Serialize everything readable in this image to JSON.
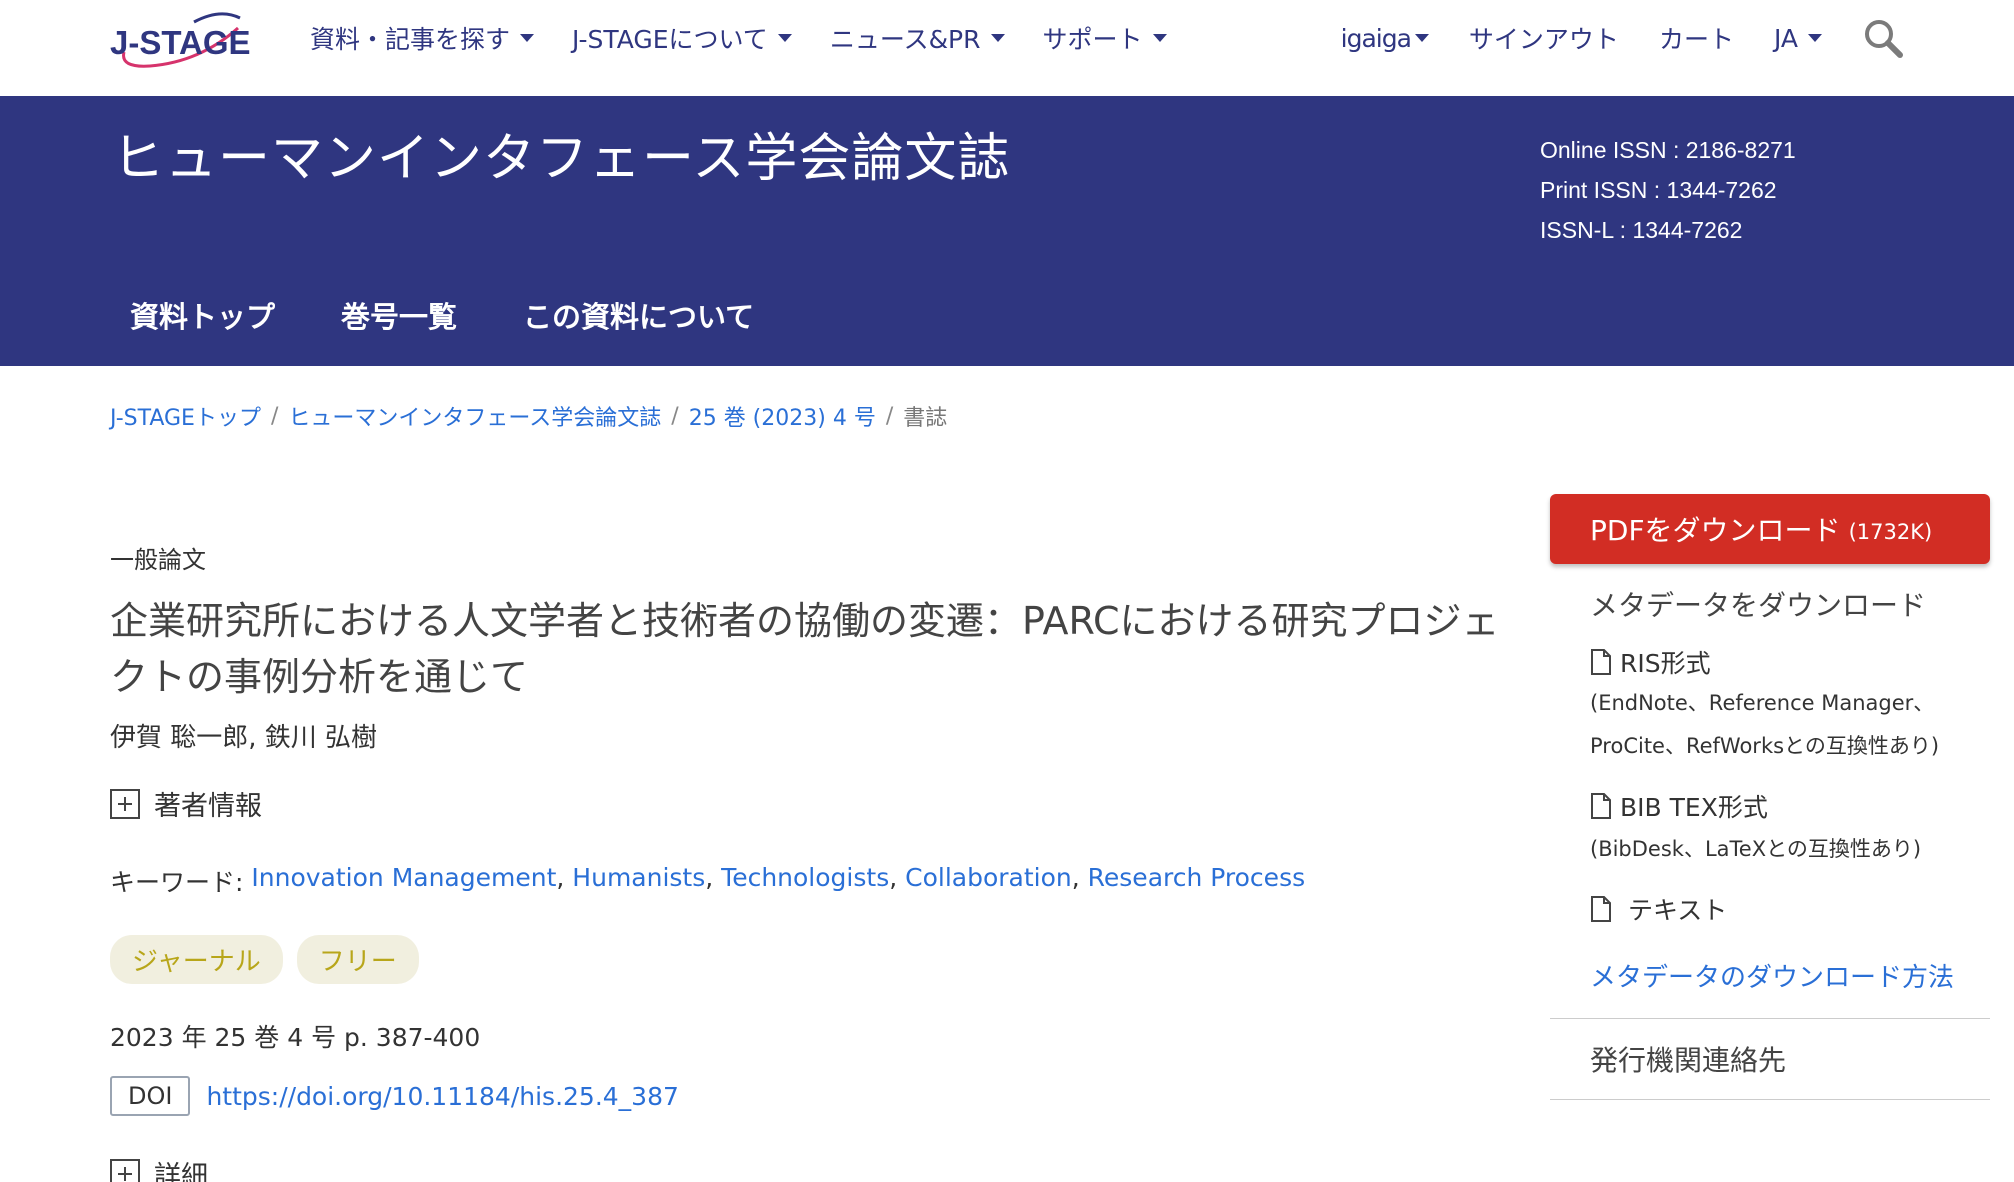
{
  "nav": {
    "menu": [
      {
        "label": "資料・記事を探す"
      },
      {
        "label": "J-STAGEについて"
      },
      {
        "label": "ニュース&PR"
      },
      {
        "label": "サポート"
      }
    ],
    "user": "igaiga",
    "signout": "サインアウト",
    "cart": "カート",
    "language": "JA"
  },
  "logo": {
    "text": "J-STAGE"
  },
  "banner": {
    "journal_title": "ヒューマンインタフェース学会論文誌",
    "issn": {
      "online": "Online ISSN : 2186-8271",
      "print": "Print ISSN : 1344-7262",
      "issn_l": "ISSN-L : 1344-7262"
    },
    "tabs": [
      "資料トップ",
      "巻号一覧",
      "この資料について"
    ]
  },
  "breadcrumb": {
    "items": [
      "J-STAGEトップ",
      "ヒューマンインタフェース学会論文誌",
      "25 巻 (2023) 4 号"
    ],
    "current": "書誌",
    "separator": "/"
  },
  "article": {
    "category": "一般論文",
    "title": "企業研究所における人文学者と技術者の協働の変遷：PARCにおける研究プロジェクトの事例分析を通じて",
    "authors": "伊賀 聡一郎, 鉄川 弘樹",
    "author_info_label": "著者情報",
    "keywords_label": "キーワード:",
    "keywords": [
      "Innovation Management",
      "Humanists",
      "Technologists",
      "Collaboration",
      "Research Process"
    ],
    "badges": [
      "ジャーナル",
      "フリー"
    ],
    "pub_info": "2023 年 25 巻 4 号 p. 387-400",
    "doi_label": "DOI",
    "doi_url": "https://doi.org/10.11184/his.25.4_387",
    "details_label": "詳細"
  },
  "sidebar": {
    "pdf_label": "PDFをダウンロード",
    "pdf_size": "(1732K)",
    "meta_heading": "メタデータをダウンロード",
    "ris_label": "RIS形式",
    "ris_note_1": "(EndNote、Reference Manager、",
    "ris_note_2": "ProCite、RefWorksとの互換性あり)",
    "bib_label": "BIB TEX形式",
    "bib_note": "(BibDesk、LaTeXとの互換性あり)",
    "text_label": "テキスト",
    "how_link": "メタデータのダウンロード方法",
    "publisher_contact": "発行機関連絡先"
  },
  "colors": {
    "brand_navy": "#2f3680",
    "link_blue": "#2a6fd6",
    "pdf_red": "#d22d24",
    "badge_bg": "#f1efdf",
    "badge_text": "#b8a61a"
  }
}
